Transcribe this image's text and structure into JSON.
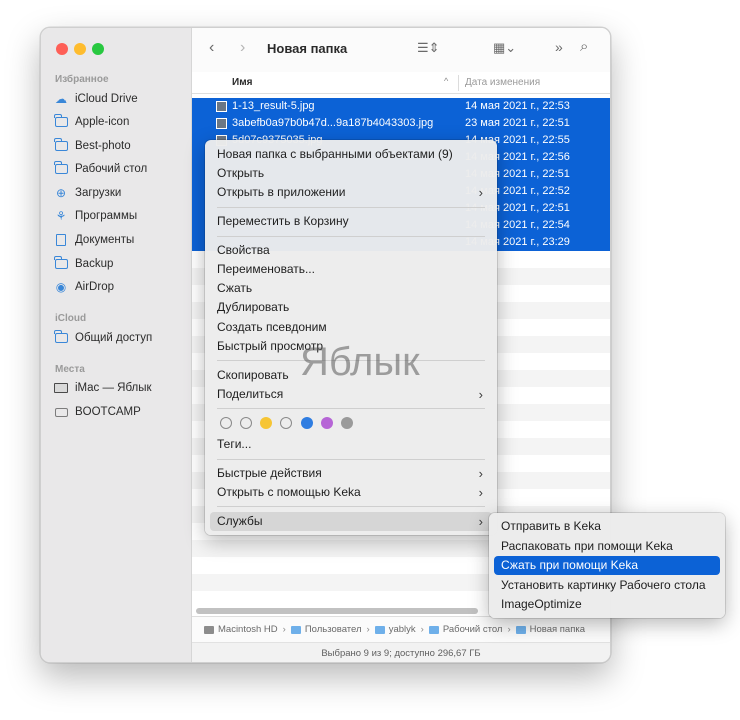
{
  "window": {
    "title": "Новая папка"
  },
  "sidebar": {
    "sections": [
      {
        "label": "Избранное"
      },
      {
        "label": "iCloud"
      },
      {
        "label": "Места"
      }
    ],
    "favorites": [
      {
        "label": "iCloud Drive",
        "icon": "cloud-icon"
      },
      {
        "label": "Apple-icon",
        "icon": "folder-icon"
      },
      {
        "label": "Best-photo",
        "icon": "folder-icon"
      },
      {
        "label": "Рабочий стол",
        "icon": "desktop-folder-icon"
      },
      {
        "label": "Загрузки",
        "icon": "downloads-icon"
      },
      {
        "label": "Программы",
        "icon": "applications-icon"
      },
      {
        "label": "Документы",
        "icon": "document-icon"
      },
      {
        "label": "Backup",
        "icon": "folder-icon"
      },
      {
        "label": "AirDrop",
        "icon": "airdrop-icon"
      }
    ],
    "icloud": [
      {
        "label": "Общий доступ",
        "icon": "shared-folder-icon"
      }
    ],
    "places": [
      {
        "label": "iMac — Яблык",
        "icon": "imac-icon"
      },
      {
        "label": "BOOTCAMP",
        "icon": "disk-icon"
      }
    ]
  },
  "columns": {
    "name": "Имя",
    "date": "Дата изменения"
  },
  "files": [
    {
      "name": "1-13_result-5.jpg",
      "date": "14 мая 2021 г., 22:53"
    },
    {
      "name": "3abefb0a97b0b47d...9a187b4043303.jpg",
      "date": "23 мая 2021 г., 22:51"
    },
    {
      "name": "5d07c9375035.jpg",
      "date": "14 мая 2021 г., 22:55"
    },
    {
      "name": "",
      "date": "14 мая 2021 г., 22:56"
    },
    {
      "name": "",
      "date": "14 мая 2021 г., 22:51"
    },
    {
      "name": "",
      "date": "14 мая 2021 г., 22:52"
    },
    {
      "name": "",
      "date": "14 мая 2021 г., 22:51"
    },
    {
      "name": "",
      "date": "14 мая 2021 г., 22:54"
    },
    {
      "name": "",
      "date": "14 мая 2021 г., 23:29"
    }
  ],
  "context_menu": {
    "items": [
      "Новая папка с выбранными объектами (9)",
      "Открыть",
      "Открыть в приложении",
      "Переместить в Корзину",
      "Свойства",
      "Переименовать...",
      "Сжать",
      "Дублировать",
      "Создать псевдоним",
      "Быстрый просмотр",
      "Скопировать",
      "Поделиться",
      "Теги...",
      "Быстрые действия",
      "Открыть с помощью Keka",
      "Службы"
    ],
    "tag_colors": [
      "#ffffff",
      "#ffffff",
      "#f6c534",
      "#ffffff",
      "#2f7de1",
      "#b665d6",
      "#9a9a9a"
    ]
  },
  "services_submenu": {
    "items": [
      "Отправить в Keka",
      "Распаковать при помощи Keka",
      "Сжать при помощи Keka",
      "Установить картинку Рабочего стола",
      "ImageOptimize"
    ]
  },
  "pathbar": [
    "Macintosh HD",
    "Пользовател",
    "yablyk",
    "Рабочий стол",
    "Новая папка"
  ],
  "status": "Выбрано 9 из 9; доступно 296,67 ГБ",
  "watermark": "Яблык",
  "colors": {
    "selection": "#0c62d6",
    "accent": "#3a87d8"
  }
}
